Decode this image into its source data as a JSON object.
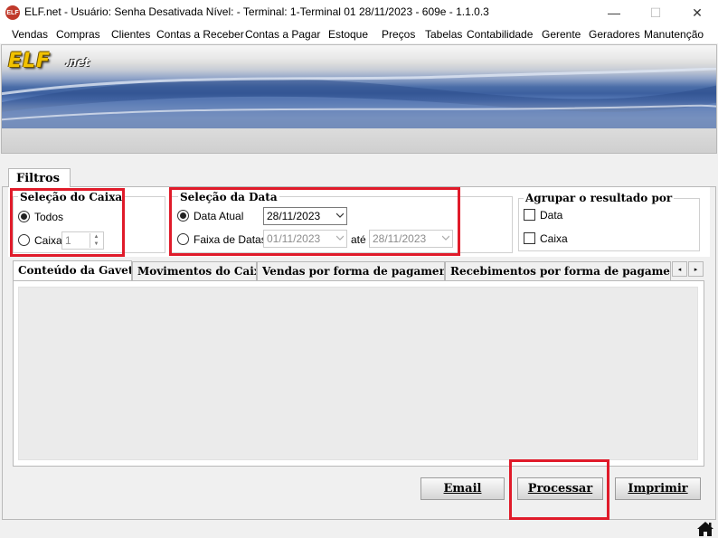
{
  "window": {
    "title": "ELF.net -   Usuário: Senha Desativada   Nível: -    Terminal: 1-Terminal 01    28/11/2023 - 609e - 1.1.0.3",
    "app_icon_text": "ELF",
    "minimize": "—",
    "maximize": "☐",
    "close": "✕"
  },
  "menu": {
    "items": [
      "Vendas",
      "Compras",
      "Clientes",
      "Contas a Receber",
      "Contas a Pagar",
      "Estoque",
      "Preços",
      "Tabelas",
      "Contabilidade",
      "Gerente",
      "Geradores",
      "Manutenção"
    ]
  },
  "banner": {
    "logo": "ELF",
    "logo_suffix": ".net"
  },
  "filtros": {
    "tab_label": "Filtros",
    "selecao_caixa": {
      "title": "Seleção do Caixa",
      "option_todos": "Todos",
      "option_caixa": "Caixa",
      "caixa_value": "1",
      "selected": "Todos"
    },
    "selecao_data": {
      "title": "Seleção da Data",
      "option_data_atual": "Data Atual",
      "data_atual_value": "28/11/2023",
      "option_faixa": "Faixa de Datas",
      "faixa_inicio": "01/11/2023",
      "ate_label": "até",
      "faixa_fim": "28/11/2023",
      "selected": "Data Atual"
    },
    "agrupar": {
      "title": "Agrupar o resultado por",
      "option_data": "Data",
      "option_caixa": "Caixa"
    }
  },
  "tabs": {
    "items": [
      "Conteúdo da Gaveta",
      "Movimentos do Caixa",
      "Vendas por forma de pagamento",
      "Recebimentos por forma de pagamento"
    ],
    "active": "Conteúdo da Gaveta",
    "scroll_left": "◂",
    "scroll_right": "▸"
  },
  "actions": {
    "email": "Email",
    "processar": "Processar",
    "imprimir": "Imprimir"
  },
  "colors": {
    "highlight_red": "#e01b2a",
    "logo_yellow": "#f2c200",
    "banner_blue": "#3c5f9f"
  },
  "icons": {
    "home": "home-icon",
    "dropdown": "chevron-down-icon"
  }
}
